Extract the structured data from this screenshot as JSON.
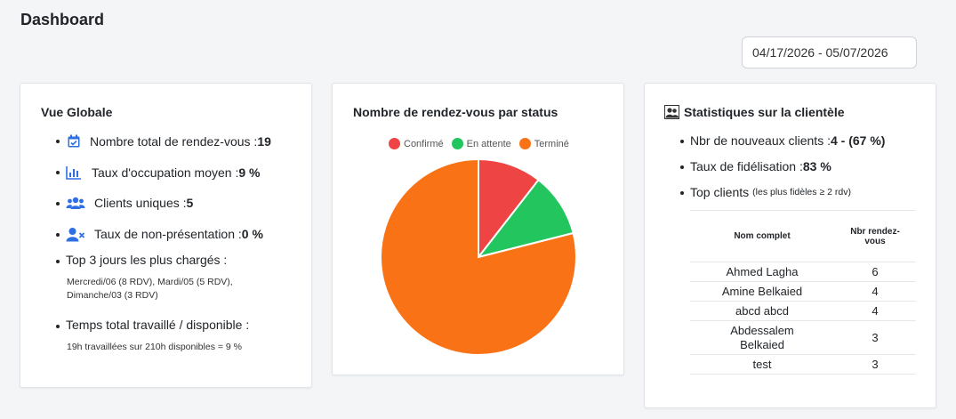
{
  "page": {
    "title": "Dashboard"
  },
  "date_range": {
    "value": "04/17/2026 - 05/07/2026"
  },
  "overview": {
    "title": "Vue Globale",
    "items": [
      {
        "icon": "calendar-check-icon",
        "label": "Nombre total de rendez-vous : ",
        "value": "19"
      },
      {
        "icon": "bar-chart-icon",
        "label": "Taux d'occupation moyen : ",
        "value": "9 %"
      },
      {
        "icon": "users-icon",
        "label": "Clients uniques : ",
        "value": "5"
      },
      {
        "icon": "user-x-icon",
        "label": "Taux de non-présentation : ",
        "value": "0 %"
      }
    ],
    "top_days_label": "Top 3 jours les plus chargés :",
    "top_days_line1": "Mercredi/06 (8 RDV), Mardi/05 (5 RDV),",
    "top_days_line2": "Dimanche/03 (3 RDV)",
    "worked_label": "Temps total travaillé / disponible :",
    "worked_detail": "19h travaillées sur 210h disponibles = 9 %"
  },
  "status_chart": {
    "title": "Nombre de rendez-vous par status",
    "chart_data": {
      "type": "pie",
      "categories": [
        "Confirmé",
        "En attente",
        "Terminé"
      ],
      "values": [
        2,
        2,
        15
      ],
      "colors": [
        "#ef4444",
        "#22c55e",
        "#f97316"
      ],
      "legend": "top"
    }
  },
  "clients": {
    "title": "Statistiques sur la clientèle",
    "new_label": "Nbr de nouveaux clients : ",
    "new_value": "4 - (67 %)",
    "loyalty_label": "Taux de fidélisation : ",
    "loyalty_value": "83 %",
    "top_label": "Top clients ",
    "top_note": "(les plus fidèles ≥ 2 rdv)",
    "table": {
      "col_name": "Nom complet",
      "col_count_1": "Nbr rendez-",
      "col_count_2": "vous",
      "rows": [
        {
          "name": "Ahmed Lagha",
          "count": "6"
        },
        {
          "name": "Amine Belkaied",
          "count": "4"
        },
        {
          "name": "abcd abcd",
          "count": "4"
        },
        {
          "name_1": "Abdessalem",
          "name_2": "Belkaied",
          "count": "3"
        },
        {
          "name": "test",
          "count": "3"
        }
      ]
    }
  },
  "colors": {
    "accent": "#2f6fe4"
  }
}
